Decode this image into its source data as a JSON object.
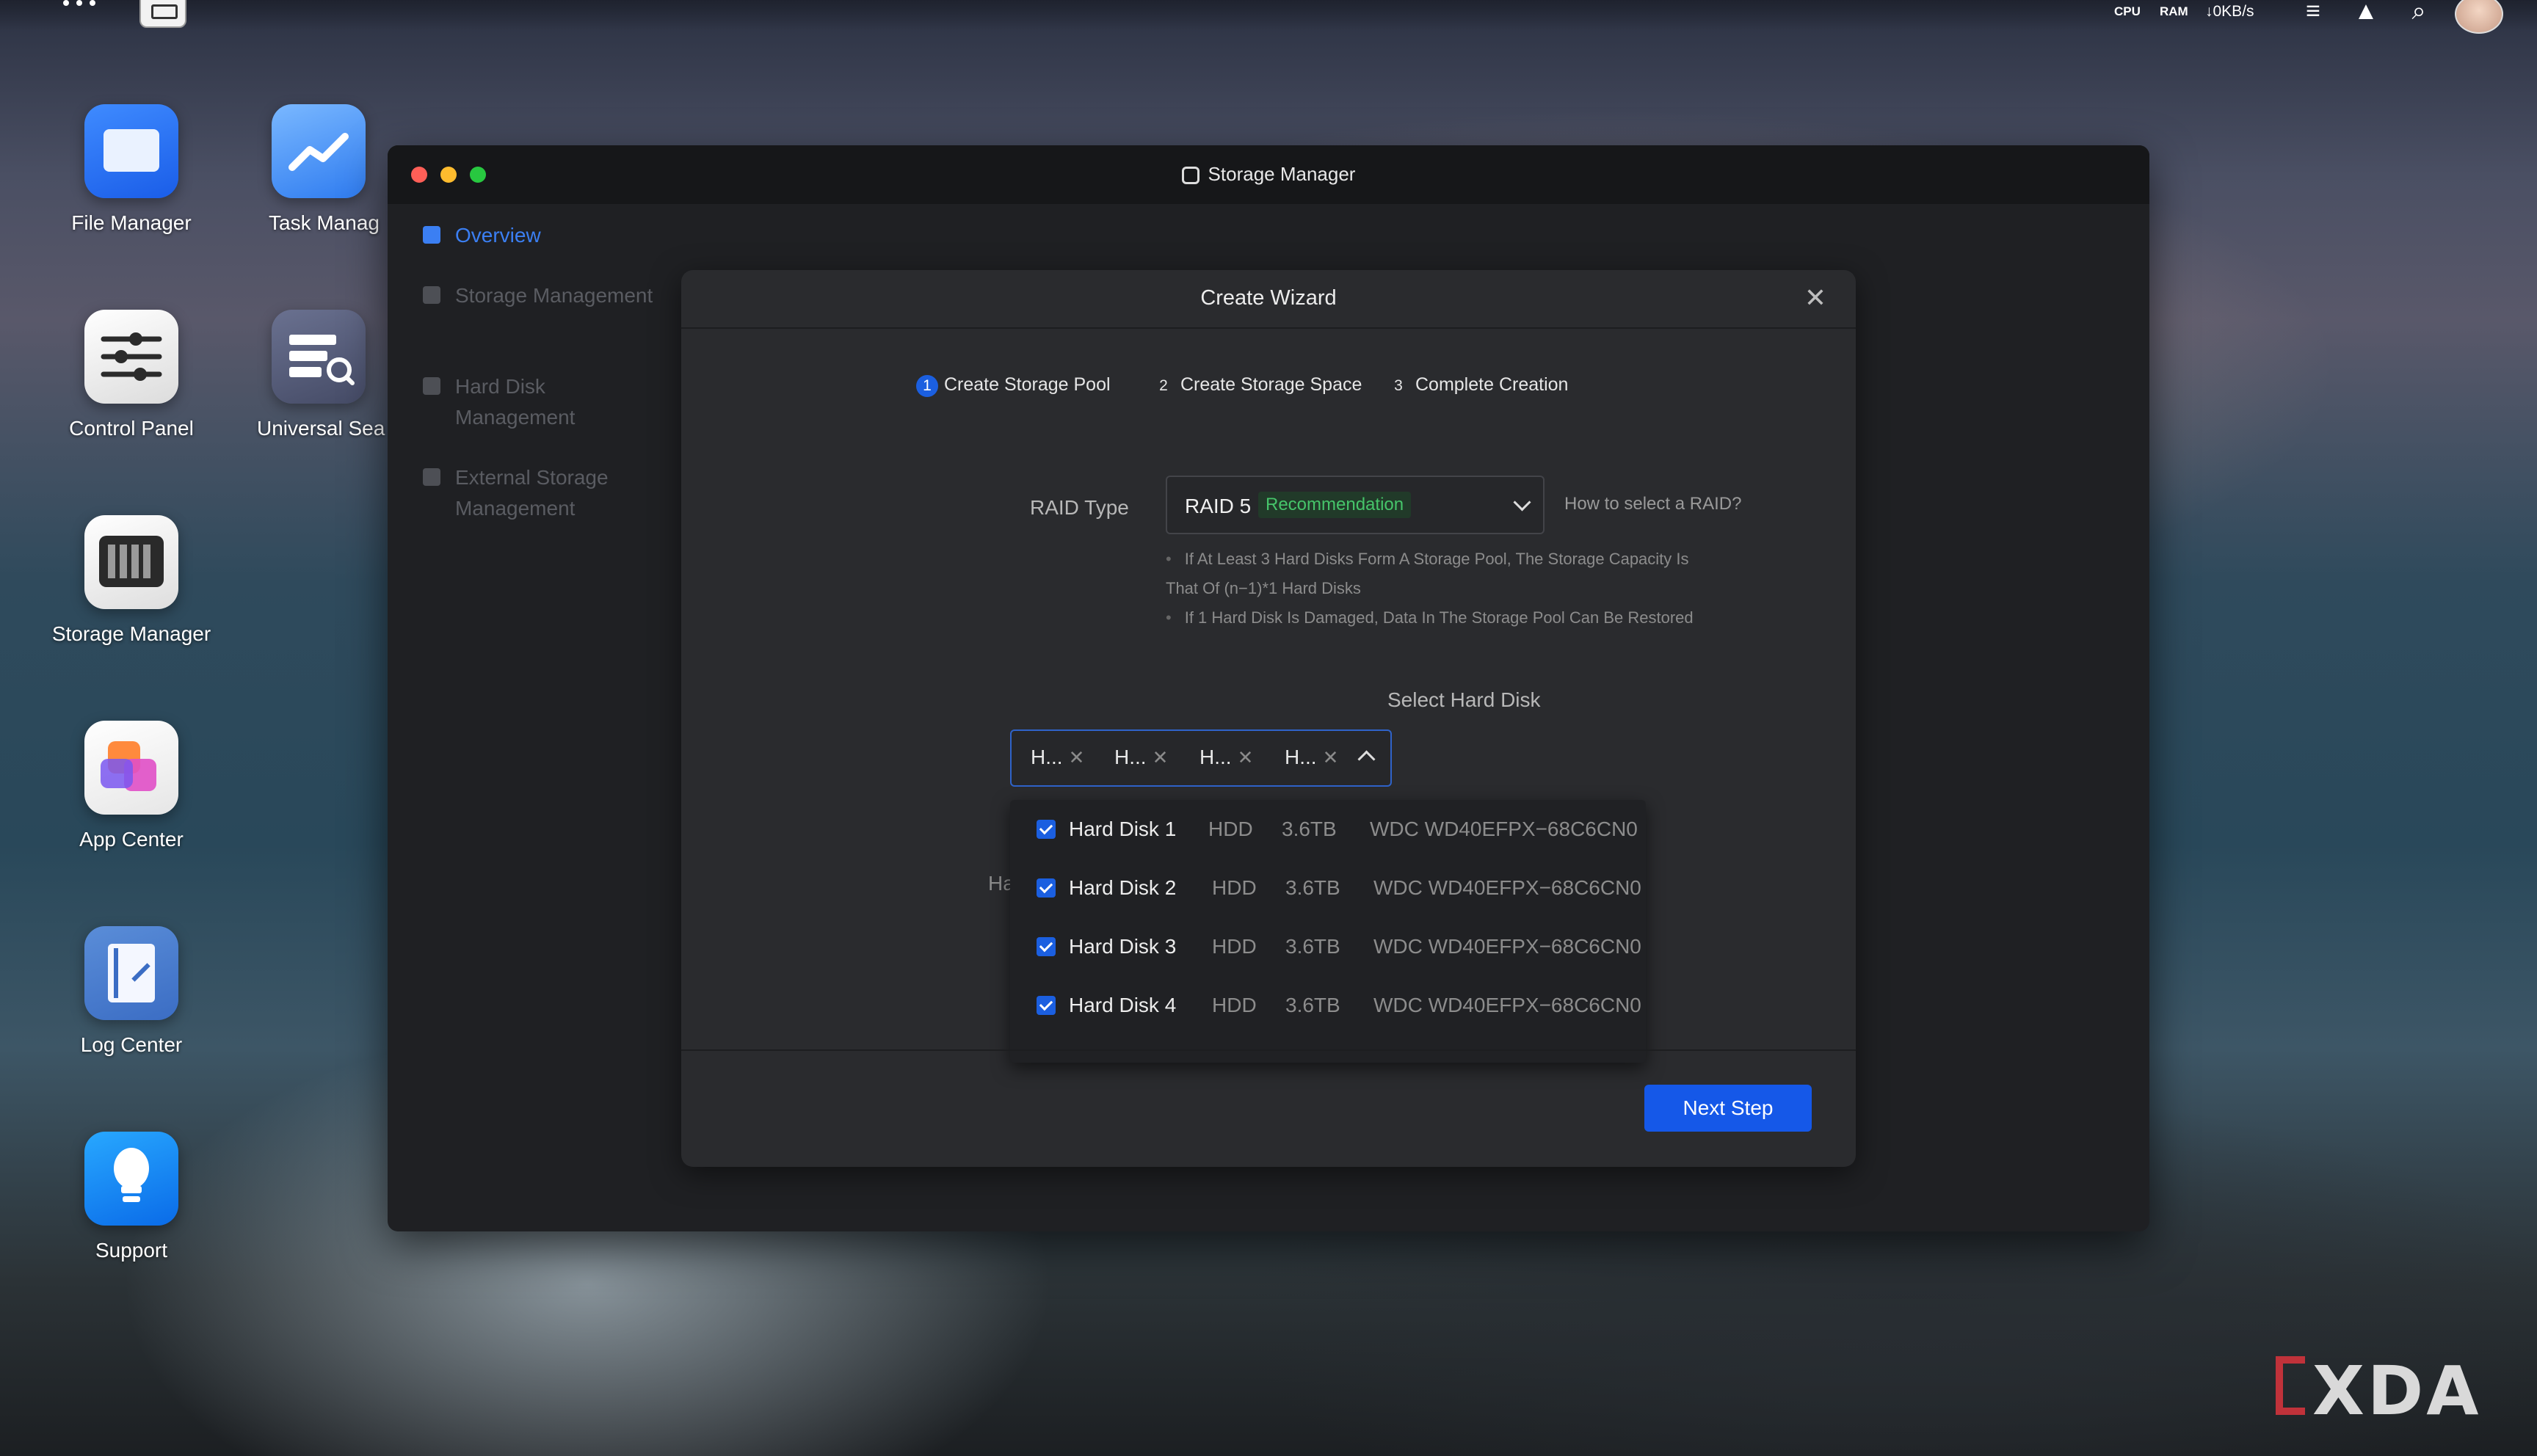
{
  "topbar": {
    "sysmon_cpu": "CPU",
    "sysmon_ram": "RAM",
    "net_speed": "↓0KB/s"
  },
  "desktop": {
    "icons": [
      {
        "label": "File Manager"
      },
      {
        "label": "Task Manag"
      },
      {
        "label": "Control Panel"
      },
      {
        "label": "Universal Sea"
      },
      {
        "label": "Storage Manager"
      },
      {
        "label": "App Center"
      },
      {
        "label": "Log Center"
      },
      {
        "label": "Support"
      }
    ]
  },
  "window": {
    "title": "Storage Manager",
    "sidebar": [
      {
        "label": "Overview",
        "active": true
      },
      {
        "label": "Storage Management"
      },
      {
        "label": "Hard Disk Management"
      },
      {
        "label": "External Storage Management"
      }
    ]
  },
  "wizard": {
    "title": "Create Wizard",
    "steps": [
      {
        "num": "1",
        "label": "Create Storage Pool",
        "active": true
      },
      {
        "num": "2",
        "label": "Create Storage Space"
      },
      {
        "num": "3",
        "label": "Complete Creation"
      }
    ],
    "raid_label": "RAID Type",
    "raid_value": "RAID 5",
    "raid_badge": "Recommendation",
    "raid_help": "How to select a RAID?",
    "raid_notes": [
      "If At Least 3 Hard Disks Form A Storage Pool, The Storage Capacity Is",
      "That Of (n−1)*1 Hard Disks",
      "If 1 Hard Disk Is Damaged, Data In The Storage Pool Can Be Restored"
    ],
    "select_disk_label": "Select Hard Disk",
    "selected_tags": [
      "H...",
      "H...",
      "H...",
      "H..."
    ],
    "behind_label": "Ha",
    "disks": [
      {
        "name": "Hard Disk 1",
        "type": "HDD",
        "size": "3.6TB",
        "model": "WDC WD40EFPX−68C6CN0",
        "checked": true
      },
      {
        "name": "Hard Disk 2",
        "type": "HDD",
        "size": "3.6TB",
        "model": "WDC WD40EFPX−68C6CN0",
        "checked": true
      },
      {
        "name": "Hard Disk 3",
        "type": "HDD",
        "size": "3.6TB",
        "model": "WDC WD40EFPX−68C6CN0",
        "checked": true
      },
      {
        "name": "Hard Disk 4",
        "type": "HDD",
        "size": "3.6TB",
        "model": "WDC WD40EFPX−68C6CN0",
        "checked": true
      }
    ],
    "next_label": "Next Step"
  },
  "watermark": "XDA",
  "colors": {
    "accent": "#1558e8",
    "recommend": "#46c46a"
  }
}
